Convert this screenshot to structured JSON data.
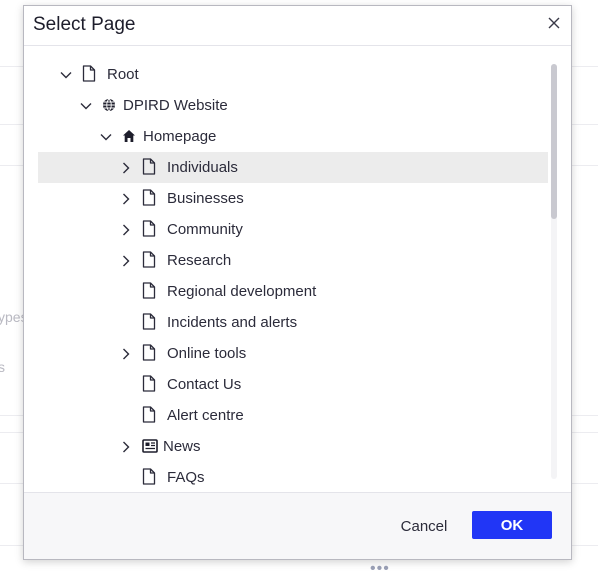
{
  "background": {
    "fragment_1": "ypes",
    "fragment_2": "s"
  },
  "dialog": {
    "title": "Select Page",
    "cancel_label": "Cancel",
    "ok_label": "OK",
    "accent_color": "#2136f6"
  },
  "tree": {
    "nodes": [
      {
        "label": "Root",
        "icon": "page-icon",
        "expand": "expanded"
      },
      {
        "label": "DPIRD Website",
        "icon": "globe-icon",
        "expand": "expanded"
      },
      {
        "label": "Homepage",
        "icon": "home-icon",
        "expand": "expanded"
      },
      {
        "label": "Individuals",
        "icon": "page-icon",
        "expand": "collapsed",
        "selected": true
      },
      {
        "label": "Businesses",
        "icon": "page-icon",
        "expand": "collapsed"
      },
      {
        "label": "Community",
        "icon": "page-icon",
        "expand": "collapsed"
      },
      {
        "label": "Research",
        "icon": "page-icon",
        "expand": "collapsed"
      },
      {
        "label": "Regional development",
        "icon": "page-icon",
        "expand": "none"
      },
      {
        "label": "Incidents and alerts",
        "icon": "page-icon",
        "expand": "none"
      },
      {
        "label": "Online tools",
        "icon": "page-icon",
        "expand": "collapsed"
      },
      {
        "label": "Contact Us",
        "icon": "page-icon",
        "expand": "none"
      },
      {
        "label": "Alert centre",
        "icon": "page-icon",
        "expand": "none"
      },
      {
        "label": "News",
        "icon": "news-icon",
        "expand": "collapsed"
      },
      {
        "label": "FAQs",
        "icon": "page-icon",
        "expand": "none"
      }
    ]
  }
}
